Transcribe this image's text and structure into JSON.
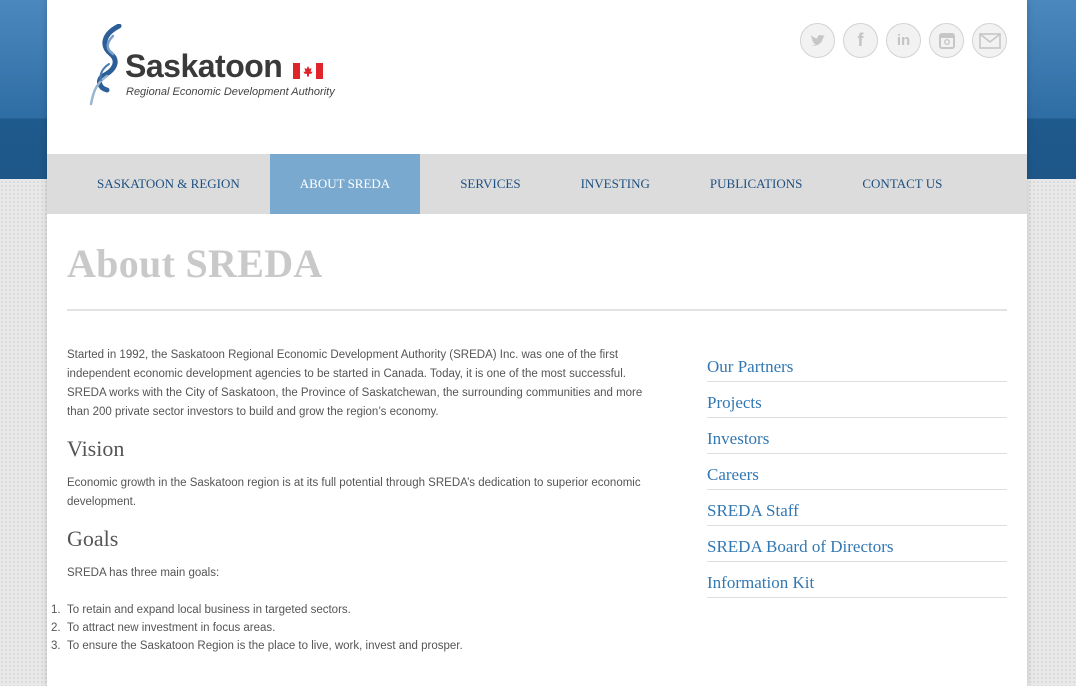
{
  "header": {
    "logo_name": "Saskatoon",
    "logo_tagline": "Regional Economic Development Authority",
    "social": [
      {
        "icon": "twitter-icon",
        "glyph": "t"
      },
      {
        "icon": "facebook-icon",
        "glyph": "f"
      },
      {
        "icon": "linkedin-icon",
        "glyph": "in"
      },
      {
        "icon": "instagram-icon",
        "glyph": "◎"
      },
      {
        "icon": "email-icon",
        "glyph": "✉"
      }
    ]
  },
  "nav": {
    "items": [
      {
        "label": "SASKATOON & REGION"
      },
      {
        "label": "ABOUT SREDA"
      },
      {
        "label": "SERVICES"
      },
      {
        "label": "INVESTING"
      },
      {
        "label": "PUBLICATIONS"
      },
      {
        "label": "CONTACT US"
      }
    ],
    "active_index": 1
  },
  "page": {
    "title": "About SREDA",
    "intro": "Started in 1992, the Saskatoon Regional Economic Development Authority (SREDA) Inc. was one of the first independent economic development agencies to be started in Canada. Today, it is one of the most successful. SREDA works with the City of Saskatoon, the Province of Saskatchewan, the surrounding communities and more than 200 private sector investors to build and grow the region’s economy.",
    "vision_heading": "Vision",
    "vision_text": "Economic growth in the Saskatoon region is at its full potential through SREDA’s dedication to superior economic development.",
    "goals_heading": "Goals",
    "goals_intro": "SREDA has three main goals:",
    "goals": [
      {
        "num": "1.",
        "text": "To retain and expand local business in targeted sectors."
      },
      {
        "num": "2.",
        "text": "To attract new investment in focus areas."
      },
      {
        "num": "3.",
        "text": "To ensure the Saskatoon Region is the place to live, work, invest and prosper."
      }
    ]
  },
  "sidebar": {
    "links": [
      {
        "label": "Our Partners"
      },
      {
        "label": "Projects"
      },
      {
        "label": "Investors"
      },
      {
        "label": "Careers"
      },
      {
        "label": "SREDA Staff"
      },
      {
        "label": "SREDA Board of Directors"
      },
      {
        "label": "Information Kit"
      }
    ]
  },
  "colors": {
    "band": "#2e6da4",
    "nav_bg": "#dcdcdc",
    "nav_active": "#7aa9d0",
    "nav_text": "#1e4f80",
    "link": "#3278b3",
    "flag_red": "#e0242b"
  }
}
